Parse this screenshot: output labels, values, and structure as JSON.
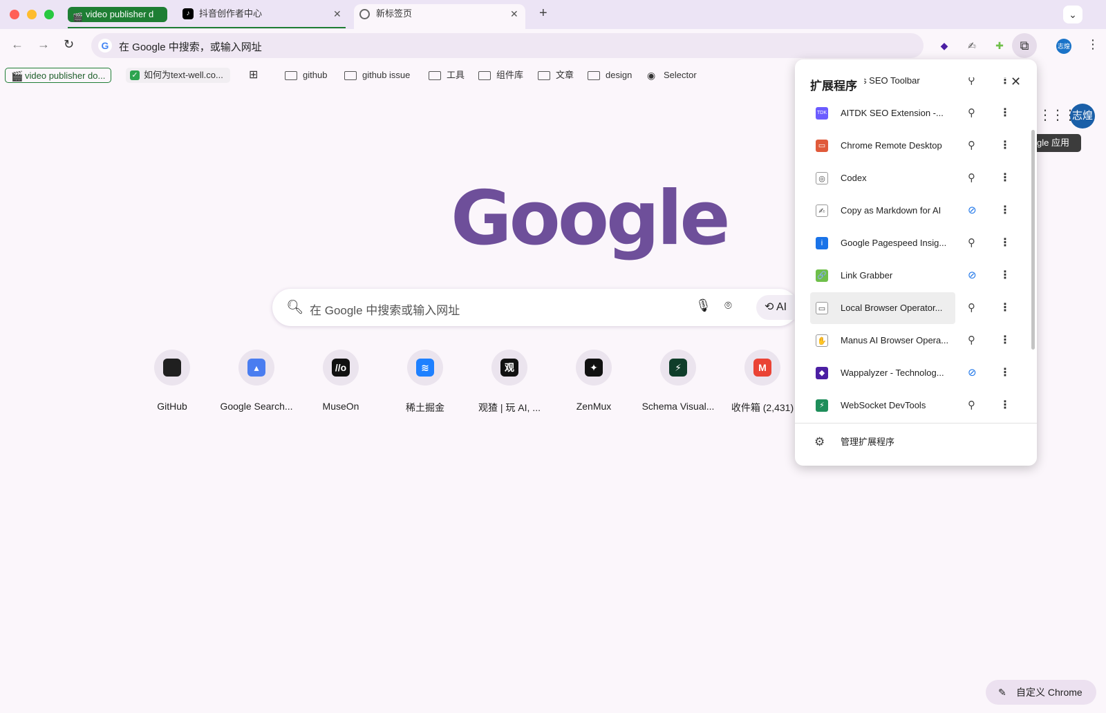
{
  "tabstrip": {
    "group_chip": "video publisher d",
    "tabs": [
      {
        "title": "抖音创作者中心"
      },
      {
        "title": "新标签页"
      }
    ],
    "new_tab": "+",
    "tabs_menu": "⌄"
  },
  "toolbar": {
    "back": "←",
    "forward": "→",
    "reload": "↻",
    "omnibox_text": "在 Google 中搜索，或输入网址",
    "profile_initials": "志煌",
    "kebab": "⋮"
  },
  "bookmarks": {
    "group1": "video publisher do...",
    "group2": "如何为text-well.co...",
    "items": [
      "github",
      "github issue",
      "工具",
      "组件库",
      "文章",
      "design",
      "Selector"
    ]
  },
  "ntp": {
    "logo": "Google",
    "search_placeholder": "在 Google 中搜索或输入网址",
    "ai_mode": "AI",
    "shortcuts": [
      {
        "label": "GitHub",
        "glyph": "",
        "color": "#1f1f1f"
      },
      {
        "label": "Google Search...",
        "glyph": "▴",
        "color": "#4a7df0"
      },
      {
        "label": "MuseOn",
        "glyph": "//o",
        "color": "#111111"
      },
      {
        "label": "稀土掘金",
        "glyph": "≋",
        "color": "#1e80ff"
      },
      {
        "label": "观猹 | 玩 AI, ...",
        "glyph": "观",
        "color": "#111111"
      },
      {
        "label": "ZenMux",
        "glyph": "✦",
        "color": "#111111"
      },
      {
        "label": "Schema Visual...",
        "glyph": "⚡",
        "color": "#0f3d2a"
      },
      {
        "label": "收件箱 (2,431)",
        "glyph": "M",
        "color": "#ea4335"
      }
    ],
    "apps_tooltip": "gle 应用",
    "avatar": "志煌",
    "customize_label": "自定义 Chrome"
  },
  "extensions": {
    "title": "扩展程序",
    "close": "✕",
    "items": [
      {
        "name": "Ahrefs SEO Toolbar",
        "color": "#ff8800",
        "glyph": "a",
        "pinned": true
      },
      {
        "name": "AITDK SEO Extension -...",
        "color": "#6b5cff",
        "glyph": "TDK",
        "pinned": true
      },
      {
        "name": "Chrome Remote Desktop",
        "color": "#e05a3a",
        "glyph": "▭",
        "pinned": true
      },
      {
        "name": "Codex",
        "color": "#ffffff",
        "glyph": "◎",
        "pinned": true
      },
      {
        "name": "Copy as Markdown for AI",
        "color": "#ffffff",
        "glyph": "✍",
        "pinned": false
      },
      {
        "name": "Google Pagespeed Insig...",
        "color": "#1a73e8",
        "glyph": "i",
        "pinned": true
      },
      {
        "name": "Link Grabber",
        "color": "#6fbf4a",
        "glyph": "🔗",
        "pinned": false
      },
      {
        "name": "Local Browser Operator...",
        "color": "#ffffff",
        "glyph": "▭",
        "pinned": true
      },
      {
        "name": "Manus AI Browser Opera...",
        "color": "#ffffff",
        "glyph": "✋",
        "pinned": true
      },
      {
        "name": "Wappalyzer - Technolog...",
        "color": "#4b1fa3",
        "glyph": "◆",
        "pinned": false
      },
      {
        "name": "WebSocket DevTools",
        "color": "#1e8e5a",
        "glyph": "⚡",
        "pinned": true
      }
    ],
    "manage": "管理扩展程序"
  }
}
